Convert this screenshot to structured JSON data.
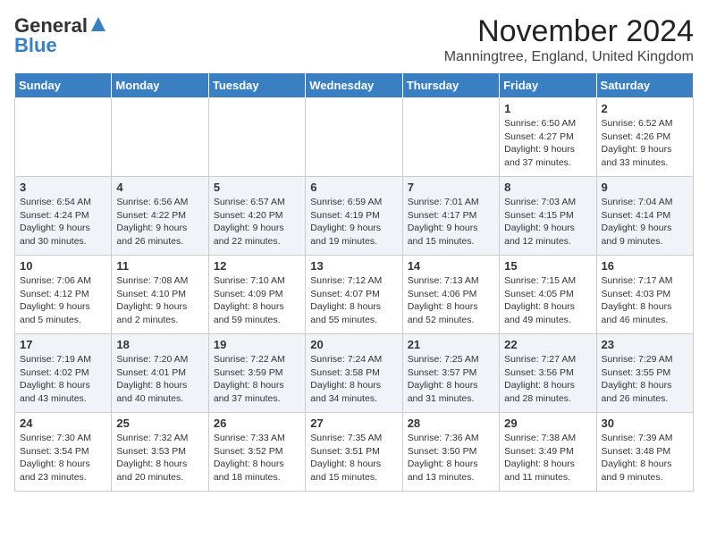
{
  "logo": {
    "general": "General",
    "blue": "Blue"
  },
  "header": {
    "month": "November 2024",
    "location": "Manningtree, England, United Kingdom"
  },
  "days_of_week": [
    "Sunday",
    "Monday",
    "Tuesday",
    "Wednesday",
    "Thursday",
    "Friday",
    "Saturday"
  ],
  "weeks": [
    [
      {
        "day": "",
        "info": ""
      },
      {
        "day": "",
        "info": ""
      },
      {
        "day": "",
        "info": ""
      },
      {
        "day": "",
        "info": ""
      },
      {
        "day": "",
        "info": ""
      },
      {
        "day": "1",
        "info": "Sunrise: 6:50 AM\nSunset: 4:27 PM\nDaylight: 9 hours and 37 minutes."
      },
      {
        "day": "2",
        "info": "Sunrise: 6:52 AM\nSunset: 4:26 PM\nDaylight: 9 hours and 33 minutes."
      }
    ],
    [
      {
        "day": "3",
        "info": "Sunrise: 6:54 AM\nSunset: 4:24 PM\nDaylight: 9 hours and 30 minutes."
      },
      {
        "day": "4",
        "info": "Sunrise: 6:56 AM\nSunset: 4:22 PM\nDaylight: 9 hours and 26 minutes."
      },
      {
        "day": "5",
        "info": "Sunrise: 6:57 AM\nSunset: 4:20 PM\nDaylight: 9 hours and 22 minutes."
      },
      {
        "day": "6",
        "info": "Sunrise: 6:59 AM\nSunset: 4:19 PM\nDaylight: 9 hours and 19 minutes."
      },
      {
        "day": "7",
        "info": "Sunrise: 7:01 AM\nSunset: 4:17 PM\nDaylight: 9 hours and 15 minutes."
      },
      {
        "day": "8",
        "info": "Sunrise: 7:03 AM\nSunset: 4:15 PM\nDaylight: 9 hours and 12 minutes."
      },
      {
        "day": "9",
        "info": "Sunrise: 7:04 AM\nSunset: 4:14 PM\nDaylight: 9 hours and 9 minutes."
      }
    ],
    [
      {
        "day": "10",
        "info": "Sunrise: 7:06 AM\nSunset: 4:12 PM\nDaylight: 9 hours and 5 minutes."
      },
      {
        "day": "11",
        "info": "Sunrise: 7:08 AM\nSunset: 4:10 PM\nDaylight: 9 hours and 2 minutes."
      },
      {
        "day": "12",
        "info": "Sunrise: 7:10 AM\nSunset: 4:09 PM\nDaylight: 8 hours and 59 minutes."
      },
      {
        "day": "13",
        "info": "Sunrise: 7:12 AM\nSunset: 4:07 PM\nDaylight: 8 hours and 55 minutes."
      },
      {
        "day": "14",
        "info": "Sunrise: 7:13 AM\nSunset: 4:06 PM\nDaylight: 8 hours and 52 minutes."
      },
      {
        "day": "15",
        "info": "Sunrise: 7:15 AM\nSunset: 4:05 PM\nDaylight: 8 hours and 49 minutes."
      },
      {
        "day": "16",
        "info": "Sunrise: 7:17 AM\nSunset: 4:03 PM\nDaylight: 8 hours and 46 minutes."
      }
    ],
    [
      {
        "day": "17",
        "info": "Sunrise: 7:19 AM\nSunset: 4:02 PM\nDaylight: 8 hours and 43 minutes."
      },
      {
        "day": "18",
        "info": "Sunrise: 7:20 AM\nSunset: 4:01 PM\nDaylight: 8 hours and 40 minutes."
      },
      {
        "day": "19",
        "info": "Sunrise: 7:22 AM\nSunset: 3:59 PM\nDaylight: 8 hours and 37 minutes."
      },
      {
        "day": "20",
        "info": "Sunrise: 7:24 AM\nSunset: 3:58 PM\nDaylight: 8 hours and 34 minutes."
      },
      {
        "day": "21",
        "info": "Sunrise: 7:25 AM\nSunset: 3:57 PM\nDaylight: 8 hours and 31 minutes."
      },
      {
        "day": "22",
        "info": "Sunrise: 7:27 AM\nSunset: 3:56 PM\nDaylight: 8 hours and 28 minutes."
      },
      {
        "day": "23",
        "info": "Sunrise: 7:29 AM\nSunset: 3:55 PM\nDaylight: 8 hours and 26 minutes."
      }
    ],
    [
      {
        "day": "24",
        "info": "Sunrise: 7:30 AM\nSunset: 3:54 PM\nDaylight: 8 hours and 23 minutes."
      },
      {
        "day": "25",
        "info": "Sunrise: 7:32 AM\nSunset: 3:53 PM\nDaylight: 8 hours and 20 minutes."
      },
      {
        "day": "26",
        "info": "Sunrise: 7:33 AM\nSunset: 3:52 PM\nDaylight: 8 hours and 18 minutes."
      },
      {
        "day": "27",
        "info": "Sunrise: 7:35 AM\nSunset: 3:51 PM\nDaylight: 8 hours and 15 minutes."
      },
      {
        "day": "28",
        "info": "Sunrise: 7:36 AM\nSunset: 3:50 PM\nDaylight: 8 hours and 13 minutes."
      },
      {
        "day": "29",
        "info": "Sunrise: 7:38 AM\nSunset: 3:49 PM\nDaylight: 8 hours and 11 minutes."
      },
      {
        "day": "30",
        "info": "Sunrise: 7:39 AM\nSunset: 3:48 PM\nDaylight: 8 hours and 9 minutes."
      }
    ]
  ]
}
